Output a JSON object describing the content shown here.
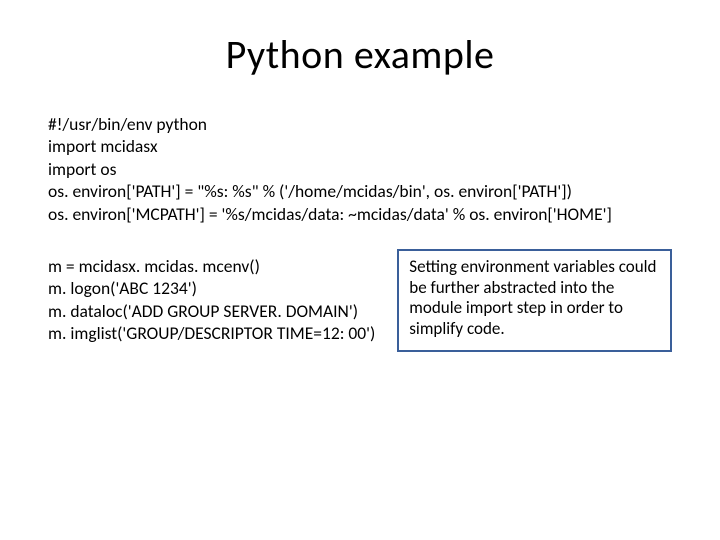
{
  "title": "Python example",
  "code_top": [
    "#!/usr/bin/env python",
    "import mcidasx",
    "import os",
    "os. environ['PATH'] = \"%s: %s\" % ('/home/mcidas/bin', os. environ['PATH'])",
    "os. environ['MCPATH'] = '%s/mcidas/data: ~mcidas/data' % os. environ['HOME']"
  ],
  "code_left": [
    "m = mcidasx. mcidas. mcenv()",
    "",
    "m. logon('ABC 1234')",
    "m. dataloc('ADD GROUP SERVER. DOMAIN')",
    "m. imglist('GROUP/DESCRIPTOR TIME=12: 00')"
  ],
  "note": "Setting environment variables could be further abstracted into the module import step in order to simplify code."
}
